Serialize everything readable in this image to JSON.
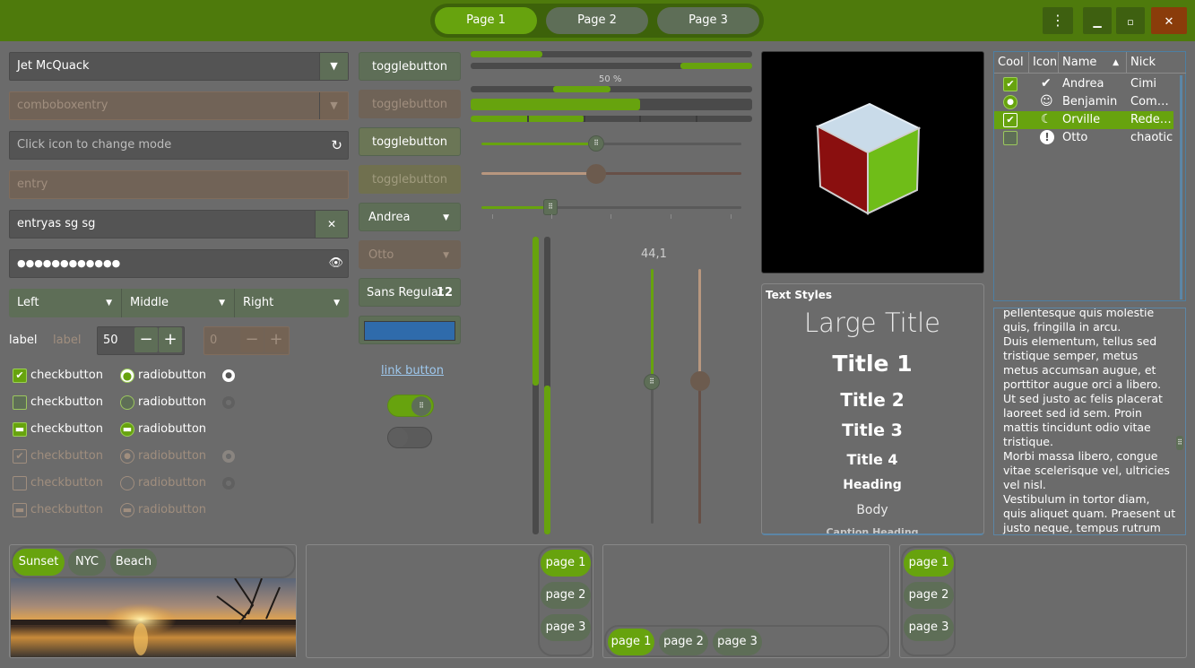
{
  "header": {
    "tabs": [
      {
        "label": "Page 1",
        "active": true
      },
      {
        "label": "Page 2",
        "active": false
      },
      {
        "label": "Page 3",
        "active": false
      }
    ],
    "menu_icon": "vertical-dots-icon",
    "minimize_icon": "minimize-icon",
    "maximize_icon": "maximize-icon",
    "close_icon": "close-icon"
  },
  "colors": {
    "accent": "#67a30e",
    "headerbar": "#4e7a0c",
    "window": "#6b6b6b",
    "button": "#5e6e57",
    "disabled_text": "#a08e7e",
    "close_button": "#8a3c0a",
    "cube_top": "#c6d8e8",
    "cube_left": "#8a0f0f",
    "cube_right": "#6fbd18"
  },
  "column1": {
    "combo_entry_value": "Jet McQuack",
    "combo_entry_disabled_value": "comboboxentry",
    "mode_entry_placeholder": "Click icon to change mode",
    "entry_disabled_value": "entry",
    "clear_entry_value": "entryas sg sg",
    "password_value": "●●●●●●●●●●●●",
    "combo_left": "Left",
    "combo_middle": "Middle",
    "combo_right": "Right",
    "label_enabled": "label",
    "label_disabled": "label",
    "spin_value": "50",
    "spin_disabled_value": "0",
    "checkbutton_label": "checkbutton",
    "radiobutton_label": "radiobutton"
  },
  "column2": {
    "toggle_label": "togglebutton",
    "combo_andrea": "Andrea",
    "combo_otto": "Otto",
    "font_name": "Sans Regular",
    "font_size": "12",
    "link_label": "link button",
    "color_swatch": "#2f6bab",
    "switch_on": true,
    "switch_off": false
  },
  "column3": {
    "progress_percent_label": "50 %",
    "progress_main": 0.6,
    "progress_label_bar": 0.5,
    "vscale_value_label": "44,1",
    "hscale1_value": 0.45,
    "hscale2_value": 0.44,
    "hscale3_value": 0.27
  },
  "image_panel": {
    "subject": "gtk-cube-logo"
  },
  "treeview": {
    "columns": [
      "Cool",
      "Icon",
      "Name",
      "Nick"
    ],
    "rows": [
      {
        "cool": true,
        "cool_style": "check",
        "icon": "checkmark-circle-icon",
        "name": "Andrea",
        "nick": "Cimi",
        "selected": false
      },
      {
        "cool": true,
        "cool_style": "radio",
        "icon": "robot-face-icon",
        "name": "Benjamin",
        "nick": "Com…",
        "selected": false
      },
      {
        "cool": true,
        "cool_style": "check",
        "icon": "moon-icon",
        "name": "Orville",
        "nick": "Rede…",
        "selected": true
      },
      {
        "cool": false,
        "cool_style": "check",
        "icon": "exclamation-circle-icon",
        "name": "Otto",
        "nick": "chaotic",
        "selected": false
      }
    ]
  },
  "text_styles": {
    "heading": "Text Styles",
    "large_title": "Large Title",
    "title1": "Title 1",
    "title2": "Title 2",
    "title3": "Title 3",
    "title4": "Title 4",
    "heading_style": "Heading",
    "body": "Body",
    "caption_heading": "Caption Heading"
  },
  "text_view": {
    "lines": [
      "pellentesque quis molestie",
      "quis, fringilla in arcu.",
      "Duis elementum, tellus sed",
      "tristique semper, metus",
      "metus accumsan augue, et",
      "porttitor augue orci a libero.",
      "Ut sed justo ac felis placerat",
      "laoreet sed id sem. Proin",
      "mattis tincidunt odio vitae",
      "tristique.",
      "Morbi massa libero, congue",
      "vitae scelerisque vel, ultricies",
      "vel nisl.",
      "Vestibulum in tortor diam,",
      "quis aliquet quam. Praesent ut",
      "justo neque, tempus rutrum"
    ]
  },
  "notebook1": {
    "tabs": [
      "Sunset",
      "NYC",
      "Beach"
    ],
    "active": 0
  },
  "notebook2": {
    "tabs": [
      "page 1",
      "page 2",
      "page 3"
    ],
    "active": 0
  },
  "notebook3": {
    "tabs": [
      "page 1",
      "page 2",
      "page 3"
    ],
    "active": 0
  },
  "notebook4": {
    "tabs": [
      "page 1",
      "page 2",
      "page 3"
    ],
    "active": 0
  }
}
